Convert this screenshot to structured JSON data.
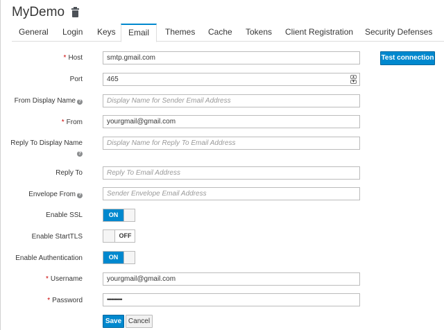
{
  "header": {
    "title": "MyDemo"
  },
  "tabs": [
    {
      "label": "General"
    },
    {
      "label": "Login"
    },
    {
      "label": "Keys"
    },
    {
      "label": "Email"
    },
    {
      "label": "Themes"
    },
    {
      "label": "Cache"
    },
    {
      "label": "Tokens"
    },
    {
      "label": "Client Registration"
    },
    {
      "label": "Security Defenses"
    }
  ],
  "form": {
    "host": {
      "label": "Host",
      "value": "smtp.gmail.com",
      "required_mark": "*"
    },
    "test_connection_label": "Test connection",
    "port": {
      "label": "Port",
      "value": "465"
    },
    "from_display_name": {
      "label": "From Display Name",
      "placeholder": "Display Name for Sender Email Address"
    },
    "from": {
      "label": "From",
      "value": "yourgmail@gmail.com",
      "required_mark": "*"
    },
    "reply_to_display_name": {
      "label": "Reply To Display Name",
      "placeholder": "Display Name for Reply To Email Address"
    },
    "reply_to": {
      "label": "Reply To",
      "placeholder": "Reply To Email Address"
    },
    "envelope_from": {
      "label": "Envelope From",
      "placeholder": "Sender Envelope Email Address"
    },
    "enable_ssl": {
      "label": "Enable SSL",
      "state": "ON"
    },
    "enable_starttls": {
      "label": "Enable StartTLS",
      "state": "OFF"
    },
    "enable_authentication": {
      "label": "Enable Authentication",
      "state": "ON"
    },
    "username": {
      "label": "Username",
      "value": "yourgmail@gmail.com",
      "required_mark": "*"
    },
    "password": {
      "label": "Password",
      "value": "••••••••••",
      "required_mark": "*"
    },
    "help_glyph": "?",
    "save_label": "Save",
    "cancel_label": "Cancel"
  },
  "colors": {
    "accent": "#0088ce",
    "required": "#cc0000"
  }
}
